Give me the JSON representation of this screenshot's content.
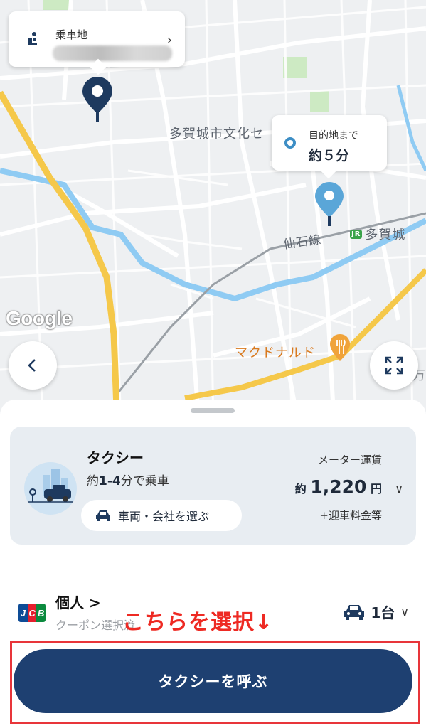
{
  "map": {
    "places": {
      "culture_center": "多賀城市文化セ",
      "station": "多賀城",
      "railway": "仙石線",
      "mcdonalds": "マクドナルド",
      "edge_label": "万"
    },
    "google_logo": "Google",
    "jr_mark": "JR",
    "pickup": {
      "label": "乗車地",
      "icon": "seat-icon"
    },
    "destination": {
      "label": "目的地まで",
      "eta": "約５分"
    },
    "colors": {
      "water": "#8fcbf3",
      "highway": "#f5c84a",
      "park": "#cdeac3",
      "pin_pickup": "#1e3a5f",
      "pin_dest": "#3d8ec5"
    }
  },
  "sheet": {
    "taxi": {
      "name": "タクシー",
      "eta_prefix": "約",
      "eta_range": "1-4",
      "eta_suffix": "分で乗車",
      "choose_label": "車両・会社を選ぶ",
      "fare_label": "メーター運賃",
      "fare_prefix": "約",
      "fare_value": "1,220",
      "fare_unit": "円",
      "fare_extra": "+迎車料金等"
    },
    "payment": {
      "card_brand": [
        "J",
        "C",
        "B"
      ],
      "name": "個人 >",
      "coupon": "クーポン選択済"
    },
    "annotation": "こちらを選択↓",
    "vehicles": {
      "count": "1台"
    },
    "call_button": "タクシーを呼ぶ"
  },
  "accent": {
    "primary": "#1e4071",
    "annotation_red": "#ee2a23"
  }
}
